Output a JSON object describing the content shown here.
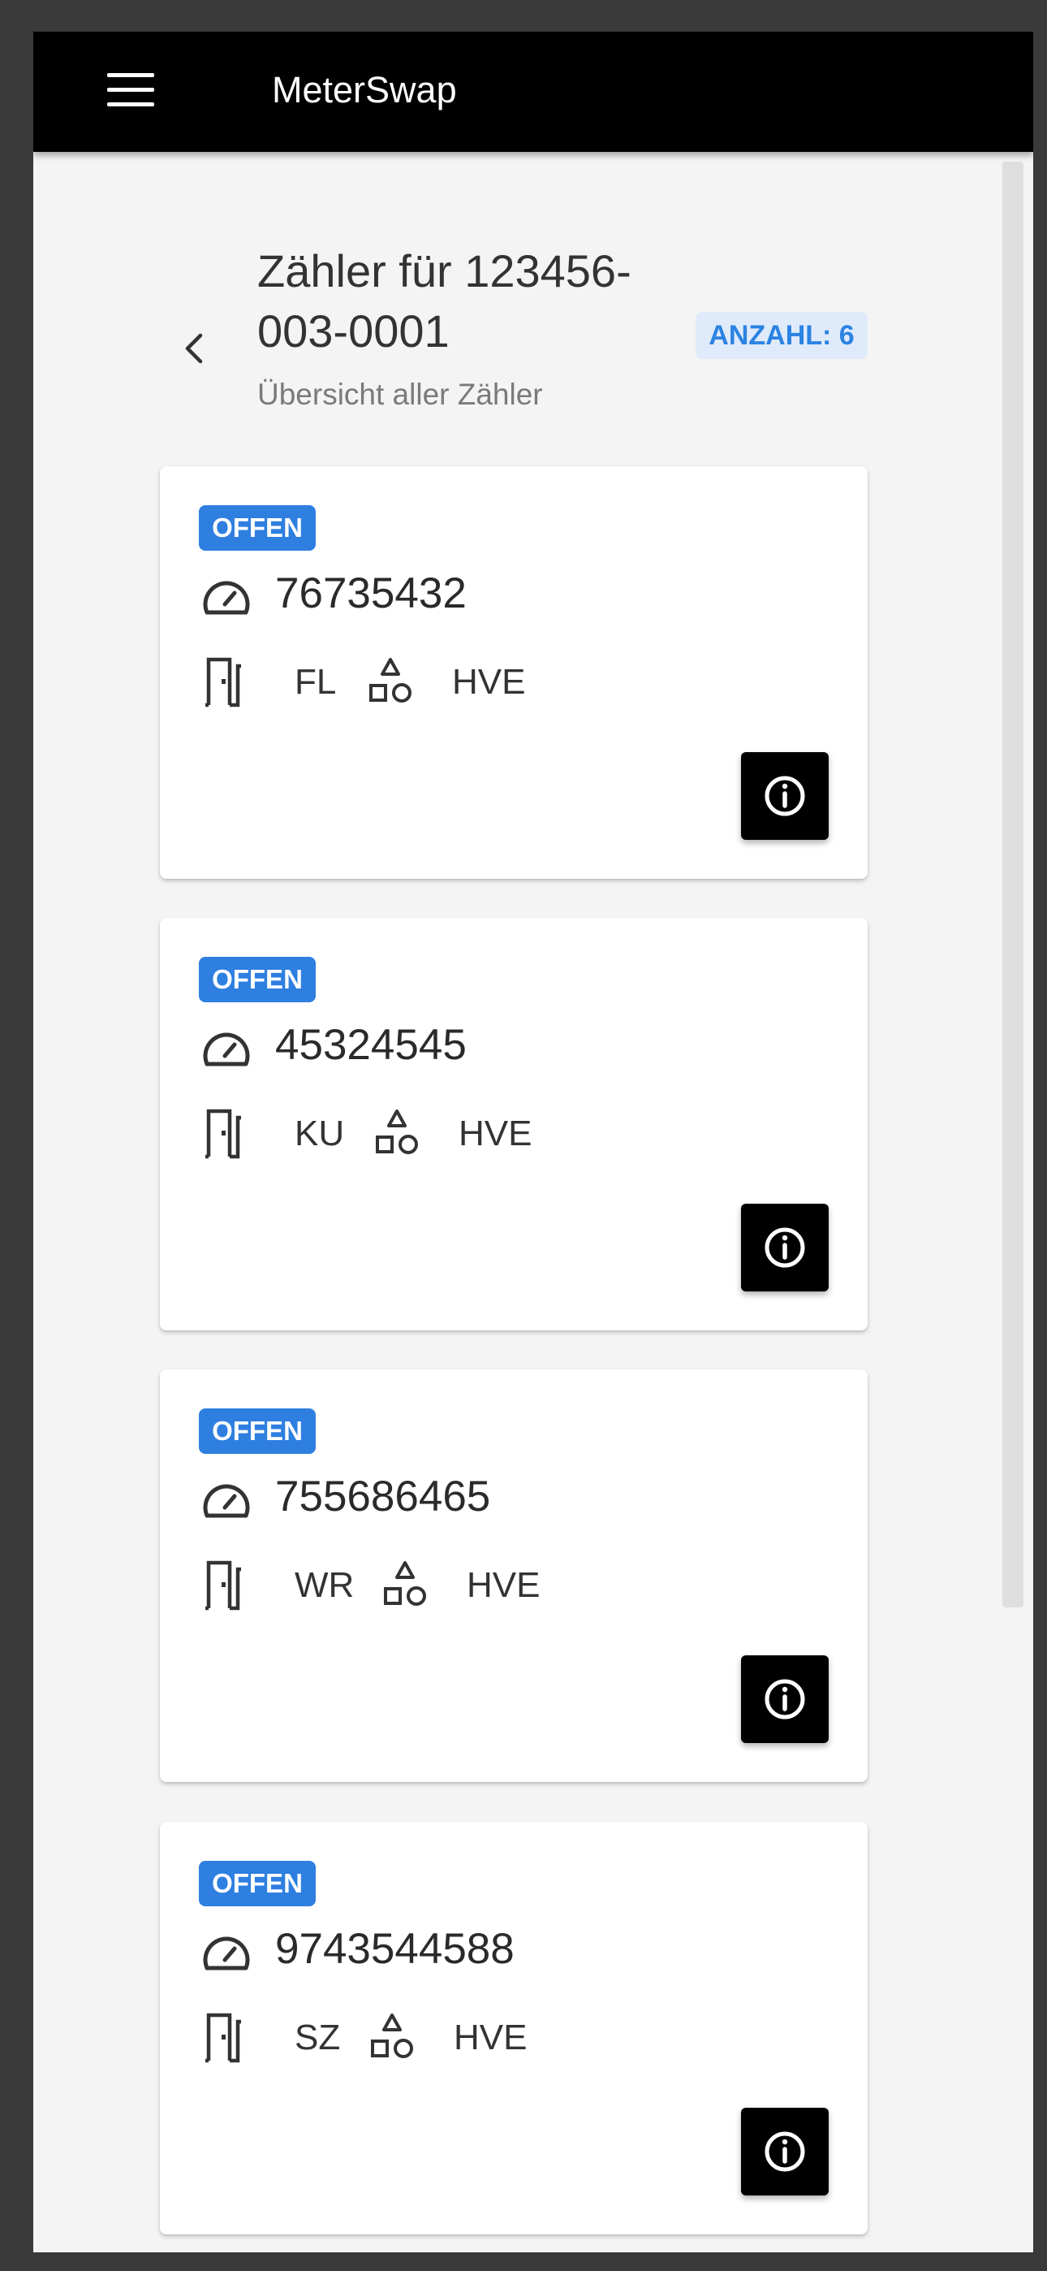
{
  "app": {
    "title": "MeterSwap"
  },
  "header": {
    "title": "Zähler für 123456-003-0001",
    "subtitle": "Übersicht aller Zähler",
    "count_badge": "ANZAHL: 6"
  },
  "icons": {
    "menu": "menu-icon",
    "back": "chevron-left-icon",
    "meter": "gauge-icon",
    "room": "door-icon",
    "type": "shapes-icon",
    "info": "info-icon"
  },
  "colors": {
    "appbar": "#000000",
    "status_badge": "#2e7fe0",
    "count_badge_bg": "#dfeafb",
    "count_badge_text": "#2b83e2"
  },
  "meters": [
    {
      "status": "OFFEN",
      "number": "76735432",
      "room": "FL",
      "type": "HVE"
    },
    {
      "status": "OFFEN",
      "number": "45324545",
      "room": "KU",
      "type": "HVE"
    },
    {
      "status": "OFFEN",
      "number": "755686465",
      "room": "WR",
      "type": "HVE"
    },
    {
      "status": "OFFEN",
      "number": "9743544588",
      "room": "SZ",
      "type": "HVE"
    }
  ]
}
